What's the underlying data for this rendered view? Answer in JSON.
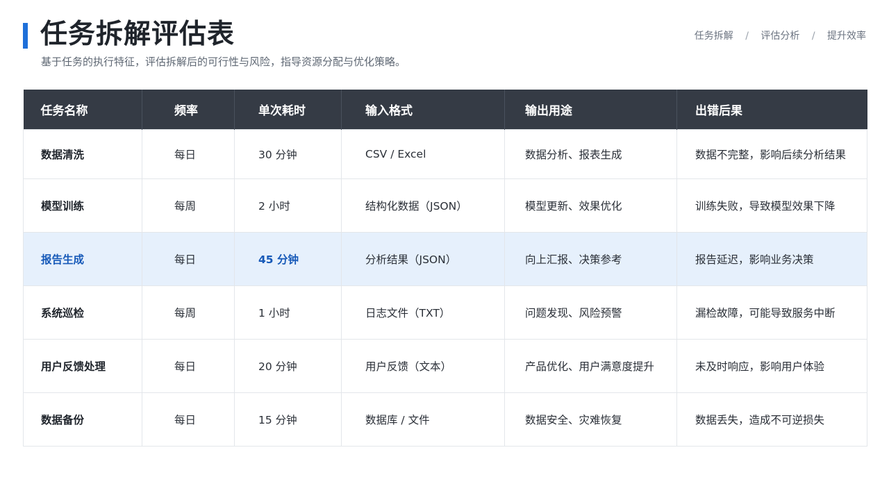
{
  "header": {
    "title": "任务拆解评估表",
    "subtitle": "基于任务的执行特征，评估拆解后的可行性与风险，指导资源分配与优化策略。",
    "accent_color": "#1e6fd9"
  },
  "breadcrumb": {
    "items": [
      "任务拆解",
      "评估分析",
      "提升效率"
    ],
    "separator": "/"
  },
  "table": {
    "header_bg": "#353b45",
    "highlight_bg": "#e6f0fc",
    "highlight_text": "#1659b8",
    "columns": [
      "任务名称",
      "频率",
      "单次耗时",
      "输入格式",
      "输出用途",
      "出错后果"
    ],
    "rows": [
      {
        "name": "数据清洗",
        "frequency": "每日",
        "duration": "30 分钟",
        "input": "CSV / Excel",
        "output": "数据分析、报表生成",
        "consequence": "数据不完整，影响后续分析结果"
      },
      {
        "name": "模型训练",
        "frequency": "每周",
        "duration": "2 小时",
        "input": "结构化数据（JSON）",
        "output": "模型更新、效果优化",
        "consequence": "训练失败，导致模型效果下降"
      },
      {
        "name": "报告生成",
        "frequency": "每日",
        "duration": "45 分钟",
        "input": "分析结果（JSON）",
        "output": "向上汇报、决策参考",
        "consequence": "报告延迟，影响业务决策"
      },
      {
        "name": "系统巡检",
        "frequency": "每周",
        "duration": "1 小时",
        "input": "日志文件（TXT）",
        "output": "问题发现、风险预警",
        "consequence": "漏检故障，可能导致服务中断"
      },
      {
        "name": "用户反馈处理",
        "frequency": "每日",
        "duration": "20 分钟",
        "input": "用户反馈（文本）",
        "output": "产品优化、用户满意度提升",
        "consequence": "未及时响应，影响用户体验"
      },
      {
        "name": "数据备份",
        "frequency": "每日",
        "duration": "15 分钟",
        "input": "数据库 / 文件",
        "output": "数据安全、灾难恢复",
        "consequence": "数据丢失，造成不可逆损失"
      }
    ]
  }
}
